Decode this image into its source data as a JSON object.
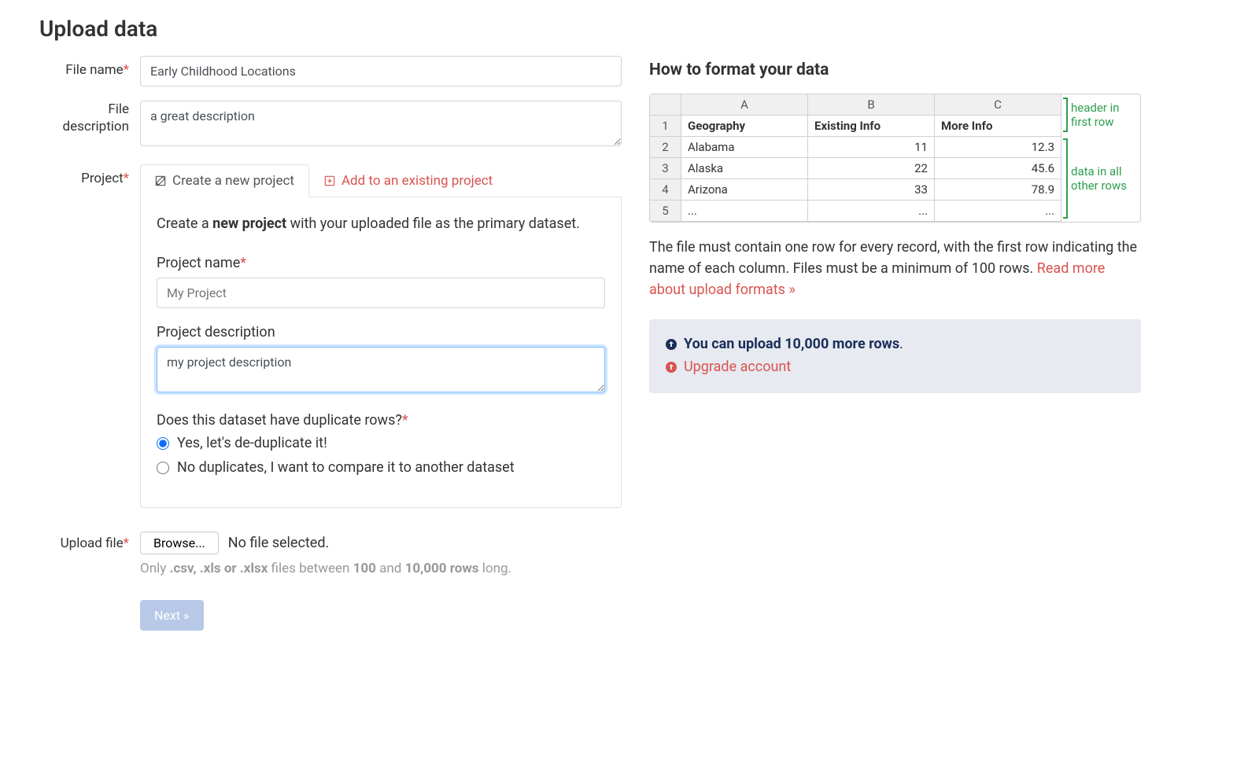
{
  "page_title": "Upload data",
  "labels": {
    "file_name": "File name",
    "file_description": "File description",
    "project": "Project",
    "upload_file": "Upload file"
  },
  "file_name_value": "Early Childhood Locations",
  "file_description_value": "a great description",
  "tabs": {
    "create": "Create a new project",
    "add": "Add to an existing project"
  },
  "intro": {
    "prefix": "Create a ",
    "bold": "new project",
    "suffix": " with your uploaded file as the primary dataset."
  },
  "project_name_label": "Project name",
  "project_name_placeholder": "My Project",
  "project_desc_label": "Project description",
  "project_desc_value": "my project description",
  "dedupe_label": "Does this dataset have duplicate rows?",
  "dedupe_yes": "Yes, let's de-duplicate it!",
  "dedupe_no": "No duplicates, I want to compare it to another dataset",
  "browse_label": "Browse...",
  "no_file_text": "No file selected.",
  "help_text": {
    "p1": "Only ",
    "b1": ".csv, .xls or .xlsx",
    "p2": " files between ",
    "b2": "100",
    "p3": " and ",
    "b3": "10,000 rows",
    "p4": " long."
  },
  "next_label": "Next »",
  "sidebar": {
    "title": "How to format your data",
    "cols": [
      "A",
      "B",
      "C"
    ],
    "headers": [
      "Geography",
      "Existing Info",
      "More Info"
    ],
    "rows": [
      {
        "n": "2",
        "a": "Alabama",
        "b": "11",
        "c": "12.3"
      },
      {
        "n": "3",
        "a": "Alaska",
        "b": "22",
        "c": "45.6"
      },
      {
        "n": "4",
        "a": "Arizona",
        "b": "33",
        "c": "78.9"
      },
      {
        "n": "5",
        "a": "...",
        "b": "...",
        "c": "..."
      }
    ],
    "ann_header": "header in first row",
    "ann_data": "data in all other rows",
    "paragraph": "The file must contain one row for every record, with the first row indicating the name of each column. Files must be a minimum of 100 rows. ",
    "read_more": "Read more about upload formats »",
    "notice_main": "You can upload 10,000 more rows",
    "notice_upgrade": "Upgrade account"
  }
}
